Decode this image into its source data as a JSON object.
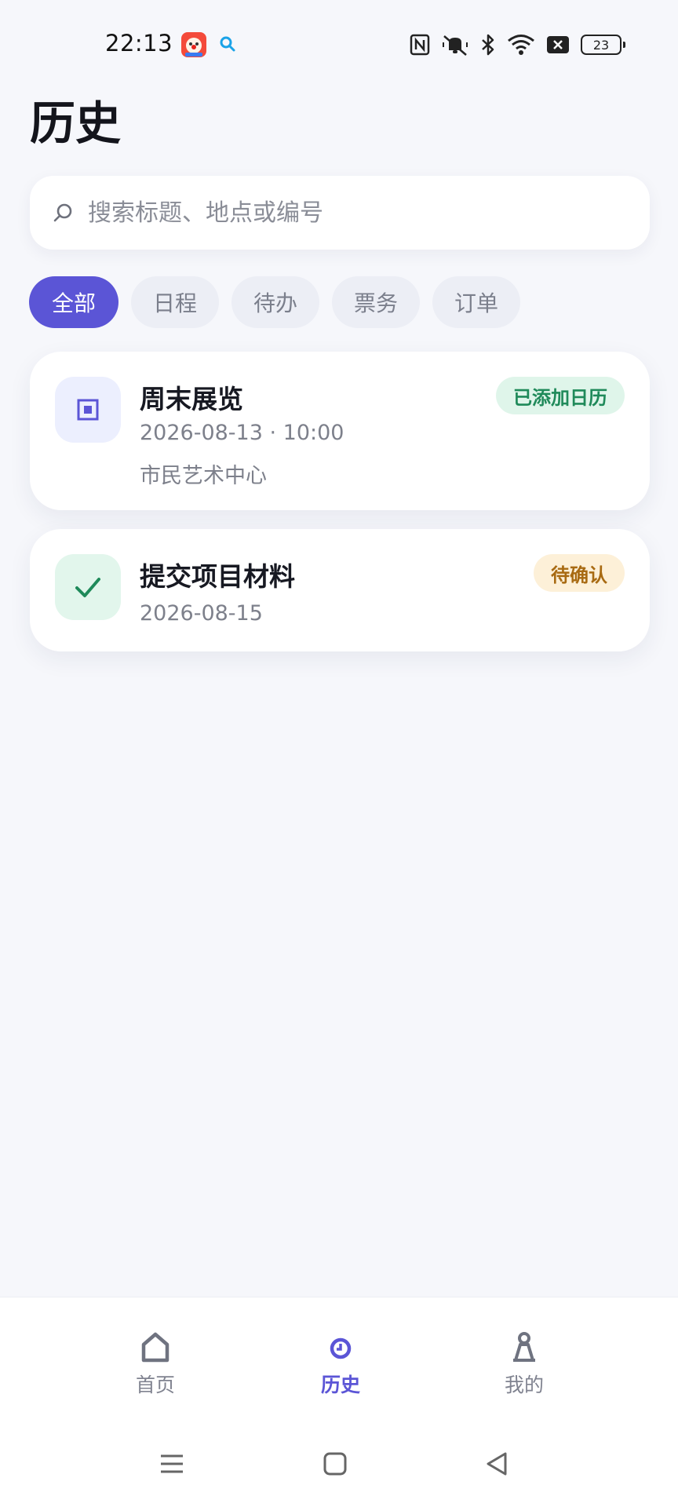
{
  "status_bar": {
    "time": "22:13",
    "battery": "23",
    "icons": [
      "nfc-icon",
      "vibrate-mute-icon",
      "bluetooth-icon",
      "wifi-icon",
      "sim-off-icon",
      "battery-icon"
    ]
  },
  "page": {
    "title": "历史"
  },
  "search": {
    "placeholder": "搜索标题、地点或编号",
    "value": ""
  },
  "filters": [
    {
      "label": "全部",
      "active": true
    },
    {
      "label": "日程",
      "active": false
    },
    {
      "label": "待办",
      "active": false
    },
    {
      "label": "票务",
      "active": false
    },
    {
      "label": "订单",
      "active": false
    }
  ],
  "history": [
    {
      "icon": "event-square-icon",
      "title": "周末展览",
      "datetime": "2026-08-13 · 10:00",
      "location": "市民艺术中心",
      "status": "已添加日历"
    },
    {
      "icon": "checkmark-icon",
      "title": "提交项目材料",
      "datetime": "2026-08-15",
      "status": "待确认"
    }
  ],
  "bottom_nav": [
    {
      "label": "首页",
      "icon": "home-icon",
      "active": false
    },
    {
      "label": "历史",
      "icon": "clock-icon",
      "active": true
    },
    {
      "label": "我的",
      "icon": "person-icon",
      "active": false
    }
  ],
  "colors": {
    "accent": "#5b55d6",
    "background": "#f6f7fb",
    "success_badge": "#dff5ea",
    "pending_badge": "#fdf0d8"
  }
}
